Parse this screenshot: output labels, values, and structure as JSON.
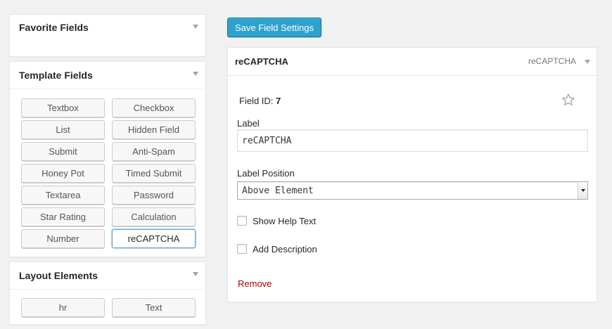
{
  "sidebar": {
    "favorite_fields": {
      "title": "Favorite Fields"
    },
    "template_fields": {
      "title": "Template Fields",
      "buttons": [
        "Textbox",
        "Checkbox",
        "List",
        "Hidden Field",
        "Submit",
        "Anti-Spam",
        "Honey Pot",
        "Timed Submit",
        "Textarea",
        "Password",
        "Star Rating",
        "Calculation",
        "Number",
        "reCAPTCHA"
      ],
      "active": "reCAPTCHA"
    },
    "layout_elements": {
      "title": "Layout Elements",
      "buttons": [
        "hr",
        "Text"
      ]
    }
  },
  "toolbar": {
    "save_label": "Save Field Settings"
  },
  "field_editor": {
    "header_title": "reCAPTCHA",
    "header_type": "reCAPTCHA",
    "field_id_label": "Field ID:",
    "field_id_value": "7",
    "label_label": "Label",
    "label_value": "reCAPTCHA",
    "label_position_label": "Label Position",
    "label_position_value": "Above Element",
    "show_help_text": "Show Help Text",
    "add_description": "Add Description",
    "remove": "Remove"
  },
  "colors": {
    "accent": "#2ea2cc",
    "remove": "#a00",
    "star": "#a0a5aa"
  }
}
